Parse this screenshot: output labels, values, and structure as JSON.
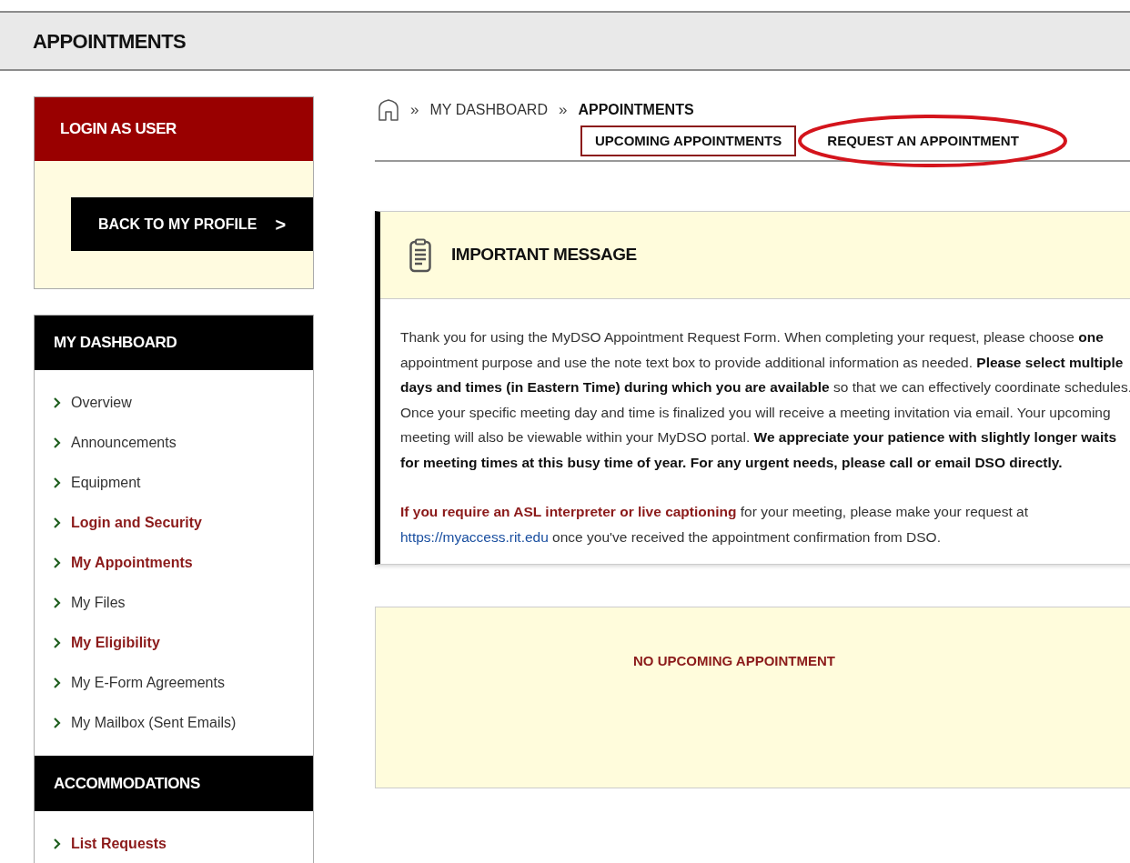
{
  "page_title": "APPOINTMENTS",
  "login_panel": {
    "title": "LOGIN AS USER",
    "button": "BACK TO MY PROFILE",
    "button_icon": ">"
  },
  "dashboard": {
    "title": "MY DASHBOARD",
    "items": [
      {
        "label": "Overview",
        "highlighted": false
      },
      {
        "label": "Announcements",
        "highlighted": false
      },
      {
        "label": "Equipment",
        "highlighted": false
      },
      {
        "label": "Login and Security",
        "highlighted": true
      },
      {
        "label": "My Appointments",
        "highlighted": true
      },
      {
        "label": "My Files",
        "highlighted": false
      },
      {
        "label": "My Eligibility",
        "highlighted": true
      },
      {
        "label": "My E-Form Agreements",
        "highlighted": false
      },
      {
        "label": "My Mailbox (Sent Emails)",
        "highlighted": false
      }
    ]
  },
  "accommodations": {
    "title": "ACCOMMODATIONS",
    "items": [
      {
        "label": "List Requests",
        "highlighted": true
      }
    ]
  },
  "breadcrumb": {
    "separator": "»",
    "items": [
      {
        "label": "MY DASHBOARD",
        "current": false
      },
      {
        "label": "APPOINTMENTS",
        "current": true
      }
    ]
  },
  "tabs": [
    {
      "label": "UPCOMING APPOINTMENTS",
      "selected": true,
      "circled": false
    },
    {
      "label": "REQUEST AN APPOINTMENT",
      "selected": false,
      "circled": true
    }
  ],
  "message": {
    "title": "IMPORTANT MESSAGE",
    "paragraph": "Thank you for using the MyDSO Appointment Request Form. When completing your request, please choose **one** appointment purpose and use the note text box to provide additional information as needed. **Please select multiple days and times (in Eastern Time) during which you are available** so that we can effectively coordinate schedules. Once your specific meeting day and time is finalized you will receive a meeting invitation via email. Your upcoming meeting will also be viewable within your MyDSO portal. **We appreciate your patience with slightly longer waits for meeting times at this busy time of year. For any urgent needs, please call or email DSO directly.**",
    "notice": {
      "lead": "If you require an ASL interpreter or live captioning",
      "before_link": " for your meeting, please make your request at ",
      "link": "https://myaccess.rit.edu",
      "after_link": " once you've received the appointment confirmation from DSO."
    }
  },
  "upcoming": {
    "empty_text": "NO UPCOMING APPOINTMENT"
  }
}
